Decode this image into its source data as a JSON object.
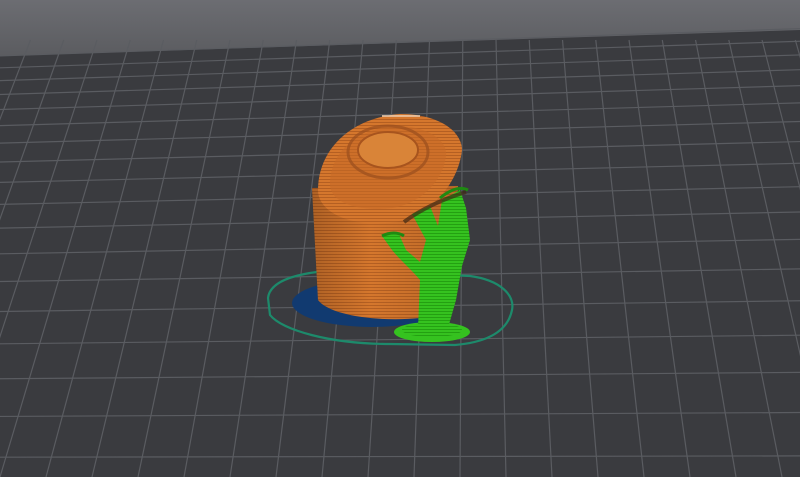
{
  "scene": {
    "type": "slicer-layer-preview",
    "colors": {
      "background_top": "#66676b",
      "bed": "#3b3c40",
      "grid_line": "#5a5c61",
      "model": "#d5772d",
      "model_shadow": "#9a4f1e",
      "support": "#35c21f",
      "support_dark": "#1f8a12",
      "first_layer": "#113a70",
      "skirt": "#1d8a6b"
    },
    "icons": [
      "printed-part-icon",
      "support-structure-icon",
      "skirt-outline-icon"
    ]
  }
}
